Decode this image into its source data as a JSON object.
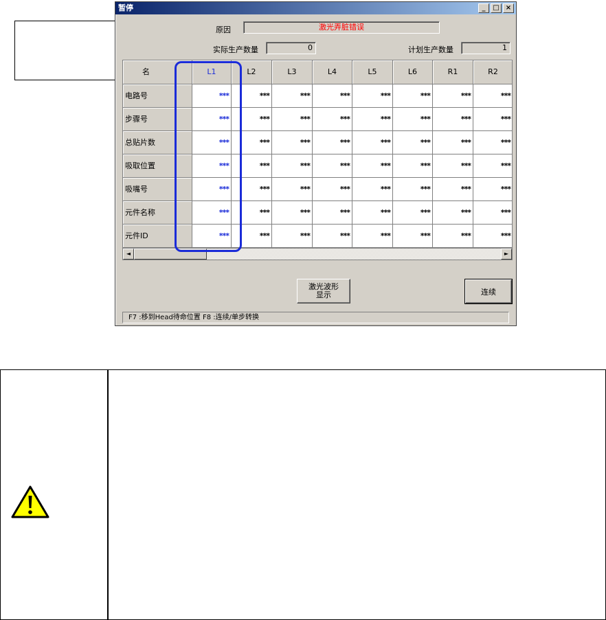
{
  "window": {
    "title": "暂停",
    "controls": {
      "minimize": "_",
      "maximize": "□",
      "close": "×"
    }
  },
  "reason": {
    "label": "原因",
    "value": "激光弄脏错误"
  },
  "actual_qty": {
    "label": "实际生产数量",
    "value": "0"
  },
  "planned_qty": {
    "label": "计划生产数量",
    "value": "1"
  },
  "grid": {
    "corner_label": "名",
    "columns": [
      "L1",
      "L2",
      "L3",
      "L4",
      "L5",
      "L6",
      "R1",
      "R2"
    ],
    "rows": [
      {
        "label": "电路号",
        "cells": [
          "***",
          "***",
          "***",
          "***",
          "***",
          "***",
          "***",
          "***"
        ]
      },
      {
        "label": "步骤号",
        "cells": [
          "***",
          "***",
          "***",
          "***",
          "***",
          "***",
          "***",
          "***"
        ]
      },
      {
        "label": "总贴片数",
        "cells": [
          "***",
          "***",
          "***",
          "***",
          "***",
          "***",
          "***",
          "***"
        ]
      },
      {
        "label": "吸取位置",
        "cells": [
          "***",
          "***",
          "***",
          "***",
          "***",
          "***",
          "***",
          "***"
        ]
      },
      {
        "label": "吸嘴号",
        "cells": [
          "***",
          "***",
          "***",
          "***",
          "***",
          "***",
          "***",
          "***"
        ]
      },
      {
        "label": "元件名称",
        "cells": [
          "***",
          "***",
          "***",
          "***",
          "***",
          "***",
          "***",
          "***"
        ]
      },
      {
        "label": "元件ID",
        "cells": [
          "***",
          "***",
          "***",
          "***",
          "***",
          "***",
          "***",
          "***"
        ]
      }
    ],
    "selected_column": "L1"
  },
  "scrollbar": {
    "left_arrow": "◄",
    "right_arrow": "►"
  },
  "buttons": {
    "laser_waveform_line1": "激光波形",
    "laser_waveform_line2": "显示",
    "continue": "连续"
  },
  "status": "F7 :移到Head待命位置   F8 :连续/单步转换",
  "colors": {
    "highlight": "#1a2bd8",
    "reason_text": "#ff0000",
    "title_bar": "#0a246a",
    "warning_yellow": "#ffff00"
  },
  "icons": {
    "warning": "warning-triangle-icon"
  }
}
